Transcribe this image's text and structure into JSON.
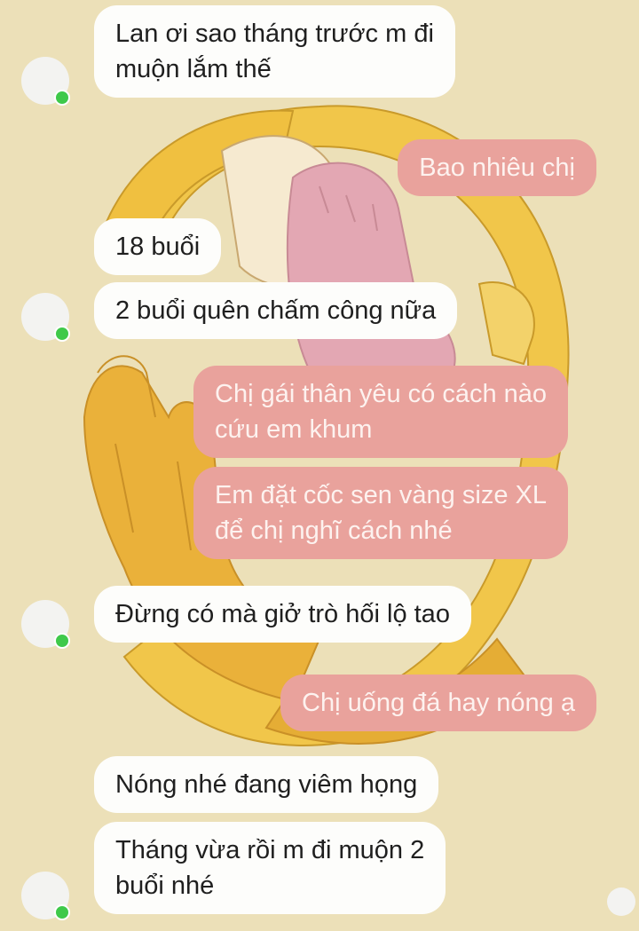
{
  "conversation": {
    "messages": [
      {
        "sender": "contact",
        "text": "Lan ơi sao tháng trước m đi\nmuộn lắm thế"
      },
      {
        "sender": "me",
        "text": "Bao nhiêu chị"
      },
      {
        "sender": "contact",
        "text": "18 buổi"
      },
      {
        "sender": "contact",
        "text": "2 buổi quên chấm công nữa"
      },
      {
        "sender": "me",
        "text": "Chị gái thân yêu có cách nào\ncứu em khum"
      },
      {
        "sender": "me",
        "text": "Em đặt cốc sen vàng size XL\nđể chị nghĩ cách nhé"
      },
      {
        "sender": "contact",
        "text": "Đừng có mà giở trò hối lộ tao"
      },
      {
        "sender": "me",
        "text": "Chị uống đá hay nóng ạ"
      },
      {
        "sender": "contact",
        "text": "Nóng nhé đang viêm họng"
      },
      {
        "sender": "contact",
        "text": "Tháng vừa rồi m đi muộn 2\nbuổi nhé"
      }
    ]
  },
  "colors": {
    "background": "#ece0b8",
    "incoming_bubble": "#fdfdfb",
    "outgoing_bubble": "#e9a29c",
    "online_status": "#3fc94a"
  }
}
